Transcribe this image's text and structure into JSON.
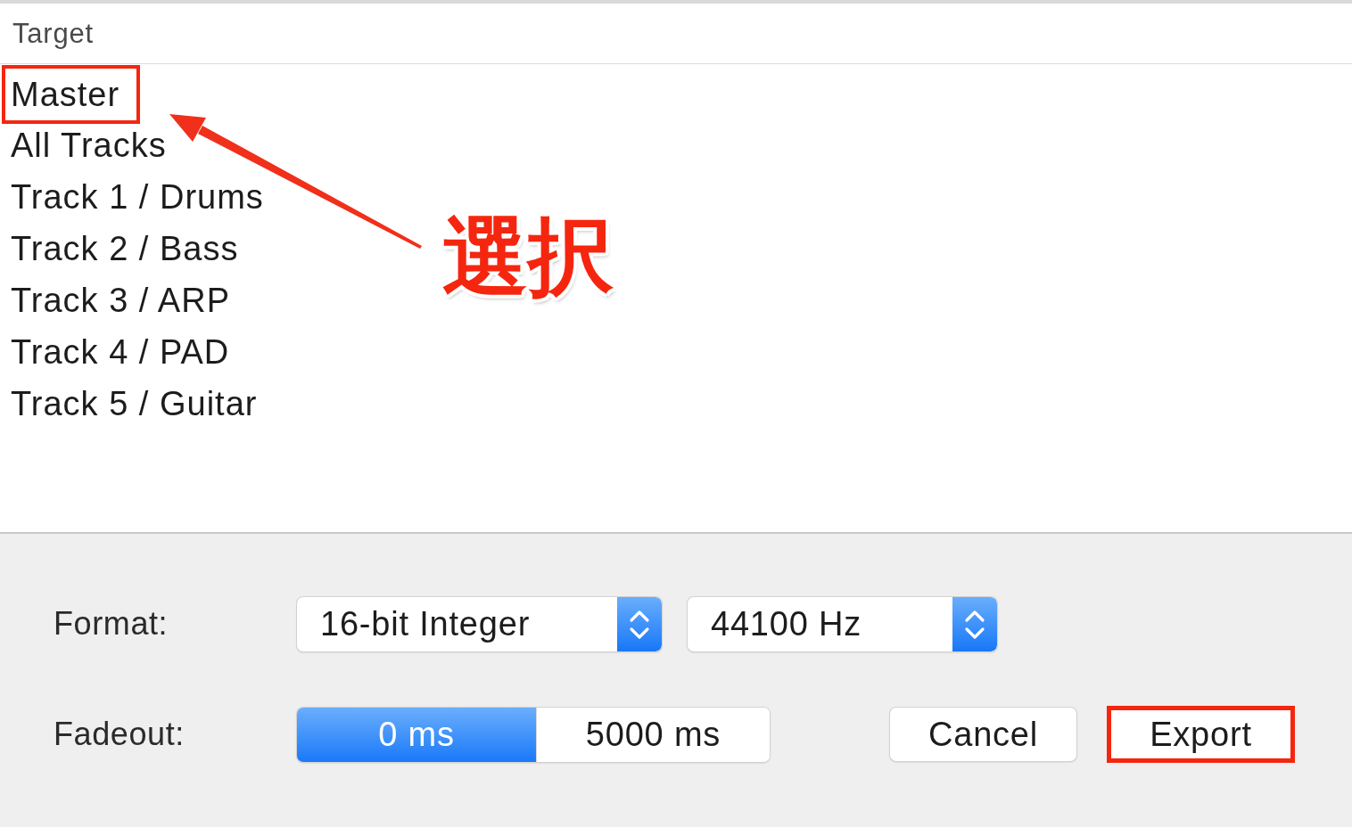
{
  "target_list": {
    "header": "Target",
    "items": [
      {
        "label": "Master",
        "highlighted": true
      },
      {
        "label": "All Tracks",
        "highlighted": false
      },
      {
        "label": "Track 1 / Drums",
        "highlighted": false
      },
      {
        "label": "Track 2 / Bass",
        "highlighted": false
      },
      {
        "label": "Track 3 / ARP",
        "highlighted": false
      },
      {
        "label": "Track 4 / PAD",
        "highlighted": false
      },
      {
        "label": "Track 5 / Guitar",
        "highlighted": false
      }
    ]
  },
  "callout": {
    "label": "選択"
  },
  "format": {
    "label": "Format:",
    "popups": [
      {
        "value": "16-bit Integer"
      },
      {
        "value": "44100 Hz"
      }
    ]
  },
  "fadeout": {
    "label": "Fadeout:",
    "segments": [
      {
        "label": "0 ms",
        "selected": true
      },
      {
        "label": "5000 ms",
        "selected": false
      }
    ]
  },
  "buttons": [
    {
      "label": "Cancel",
      "highlighted": false
    },
    {
      "label": "Export",
      "highlighted": true
    }
  ]
}
